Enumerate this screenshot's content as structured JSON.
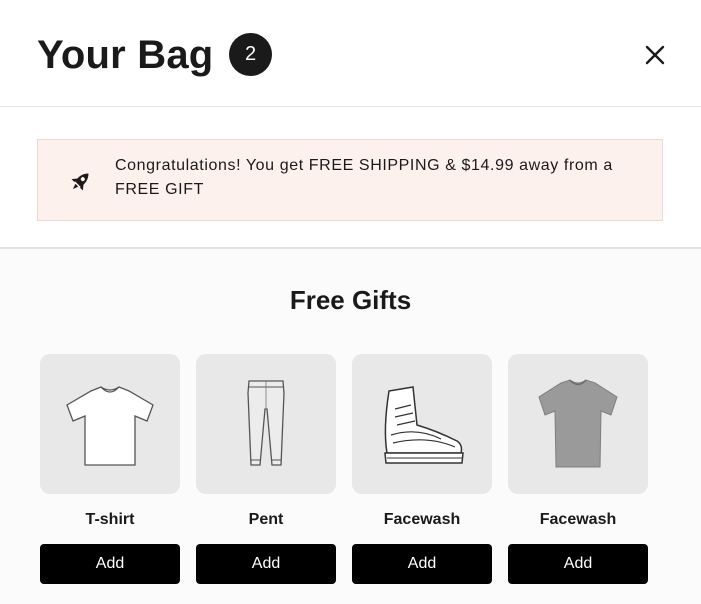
{
  "header": {
    "title": "Your Bag",
    "badge_count": "2",
    "close_icon": "close-icon"
  },
  "banner": {
    "icon": "rocket-icon",
    "message": "Congratulations! You get FREE SHIPPING & $14.99 away from a FREE GIFT"
  },
  "gifts": {
    "title": "Free Gifts",
    "items": [
      {
        "name": "T-shirt",
        "button": "Add",
        "image": "white-tshirt-image"
      },
      {
        "name": "Pent",
        "button": "Add",
        "image": "pants-image"
      },
      {
        "name": "Facewash",
        "button": "Add",
        "image": "sneaker-image"
      },
      {
        "name": "Facewash",
        "button": "Add",
        "image": "grey-tshirt-image"
      }
    ]
  },
  "colors": {
    "banner_bg": "#fdf1ee",
    "button_bg": "#000000",
    "thumb_bg": "#e8e8e8"
  }
}
